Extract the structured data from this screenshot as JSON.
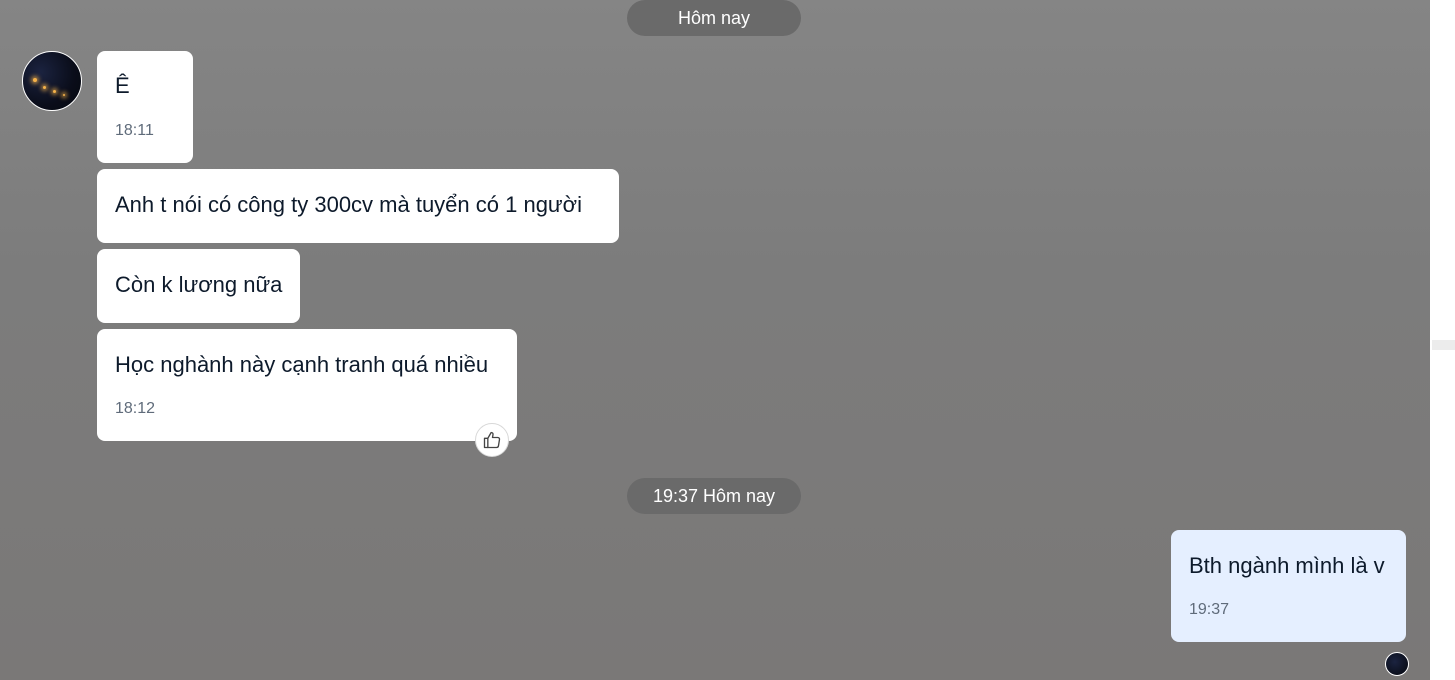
{
  "date_separators": [
    {
      "label": "Hôm nay"
    },
    {
      "label": "19:37 Hôm nay"
    }
  ],
  "messages": [
    {
      "text": "Ê",
      "time": "18:11"
    },
    {
      "text": "Anh t nói có công ty 300cv mà tuyển có 1 người"
    },
    {
      "text": "Còn k lương nữa"
    },
    {
      "text": "Học nghành này cạnh tranh quá nhiều",
      "time": "18:12"
    },
    {
      "text": "Bth ngành mình là v",
      "time": "19:37"
    }
  ],
  "icons": {
    "like": "thumbs-up-icon",
    "avatar": "contact-avatar",
    "seen": "seen-avatar"
  },
  "colors": {
    "incoming_bubble": "#ffffff",
    "outgoing_bubble": "#e5efff",
    "date_pill": "#6a6a6a",
    "time_text": "#5f6b7a"
  }
}
